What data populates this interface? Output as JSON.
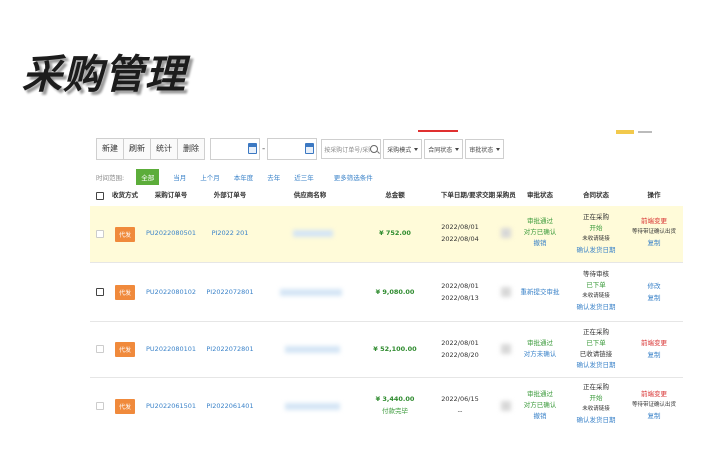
{
  "slide_title": "采购管理",
  "toolbar": {
    "buttons": [
      "新建",
      "刷新",
      "统计",
      "删除"
    ],
    "date_separator": "-",
    "search_placeholder": "按采购订单号/采购...",
    "selects": [
      "采购模式",
      "合同状态",
      "审批状态"
    ]
  },
  "filter": {
    "label": "时间范围:",
    "options": [
      "全部",
      "当月",
      "上个月",
      "本年度",
      "去年",
      "近三年"
    ],
    "active": "全部",
    "more": "更多筛选条件"
  },
  "table": {
    "headers": [
      "收货方式",
      "采购订单号",
      "外部订单号",
      "供应商名称",
      "总金额",
      "下单日期/要求交期",
      "采购员",
      "审批状态",
      "合同状态",
      "操作"
    ],
    "rows": [
      {
        "method": "代发",
        "po": "PU2022080501",
        "ext": "PI2022    201",
        "amount": "¥ 752.00",
        "amount_sub": "",
        "date1": "2022/08/01",
        "date2": "2022/08/04",
        "approval": [
          "审批通过",
          "对方已确认",
          "撤销"
        ],
        "contract": [
          "正在采购",
          "开始",
          "未收请链接",
          "确认发货日期"
        ],
        "ops": [
          "前端变更",
          "等待带证确认出货",
          "复制"
        ]
      },
      {
        "method": "代发",
        "po": "PU2022080102",
        "ext": "PI2022072801",
        "amount": "¥ 9,080.00",
        "amount_sub": "",
        "date1": "2022/08/01",
        "date2": "2022/08/13",
        "approval": [
          "重新提交审批"
        ],
        "contract": [
          "等待审核",
          "已下单",
          "未收请链接",
          "确认发货日期"
        ],
        "ops": [
          "修改",
          "复制"
        ]
      },
      {
        "method": "代发",
        "po": "PU2022080101",
        "ext": "PI2022072801",
        "amount": "¥ 52,100.00",
        "amount_sub": "",
        "date1": "2022/08/01",
        "date2": "2022/08/20",
        "approval": [
          "审批通过",
          "对方未确认"
        ],
        "contract": [
          "正在采购",
          "已下单",
          "已收请链接",
          "确认发货日期"
        ],
        "ops": [
          "前端变更",
          "复制"
        ]
      },
      {
        "method": "代发",
        "po": "PU2022061501",
        "ext": "PI2022061401",
        "amount": "¥ 3,440.00",
        "amount_sub": "付款完毕",
        "date1": "2022/06/15",
        "date2": "--",
        "approval": [
          "审批通过",
          "对方已确认",
          "撤销"
        ],
        "contract": [
          "正在采购",
          "开始",
          "未收请链接",
          "确认发货日期"
        ],
        "ops": [
          "前端变更",
          "等待带证确认出货",
          "复制"
        ]
      }
    ]
  }
}
